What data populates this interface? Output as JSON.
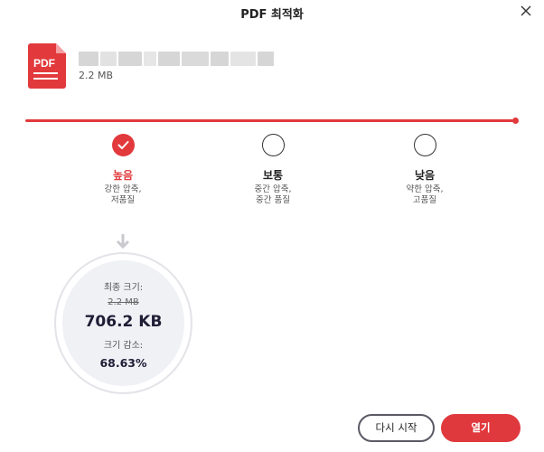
{
  "dialog": {
    "title": "PDF 최적화",
    "close_icon": "close-icon"
  },
  "file": {
    "icon": "pdf-file-icon",
    "icon_text": "PDF",
    "size": "2.2 MB"
  },
  "slider": {
    "value_fraction": 1.0,
    "color": "#e2393c"
  },
  "options": [
    {
      "label": "높음",
      "desc": "강한 압축,\n저품질",
      "selected": true
    },
    {
      "label": "보통",
      "desc": "중간 압축,\n중간 품질",
      "selected": false
    },
    {
      "label": "낮음",
      "desc": "약한 압축,\n고품질",
      "selected": false
    }
  ],
  "result": {
    "final_size_label": "최종 크기:",
    "original_size": "2.2 MB",
    "final_size": "706.2 KB",
    "reduction_label": "크기 감소:",
    "reduction_pct": "68.63%"
  },
  "buttons": {
    "restart_label": "다시 시작",
    "open_label": "열기"
  },
  "colors": {
    "accent": "#e2393c",
    "text_dark": "#1d1d35"
  }
}
